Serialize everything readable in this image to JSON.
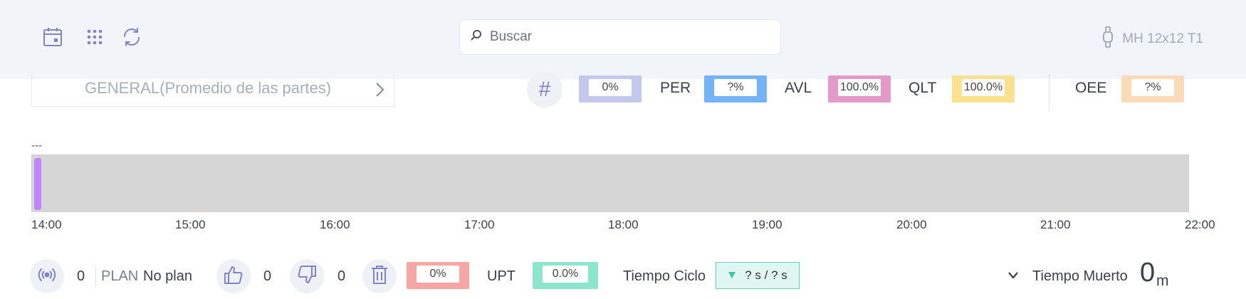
{
  "topbar": {
    "icons": [
      "calendar-icon",
      "grid-icon",
      "refresh-icon"
    ],
    "search": {
      "placeholder": "Buscar",
      "value": ""
    },
    "device": {
      "icon": "watch-icon",
      "name": "MH 12x12 T1"
    }
  },
  "part_selector": {
    "label": "GENERAL(Promedio de las partes)"
  },
  "metrics": {
    "hash_icon": "#",
    "count": {
      "value": "0%",
      "color": "#c5c8ee"
    },
    "per": {
      "label": "PER",
      "value": "?%",
      "color": "#74b3f7"
    },
    "avl": {
      "label": "AVL",
      "value": "100.0%",
      "color": "#e49ac8"
    },
    "qlt": {
      "label": "QLT",
      "value": "100.0%",
      "color": "#fbe08e"
    },
    "oee": {
      "label": "OEE",
      "value": "?%",
      "color": "#fcd9b7"
    }
  },
  "timeline": {
    "title": "---",
    "segment_color": "#c084fc",
    "segment_fraction": 0.01,
    "ticks": [
      "14:00",
      "15:00",
      "16:00",
      "17:00",
      "18:00",
      "19:00",
      "20:00",
      "21:00",
      "22:00"
    ]
  },
  "bottom": {
    "signal_count": "0",
    "plan_label": "PLAN",
    "plan_value": "No plan",
    "thumbs_up_count": "0",
    "thumbs_down_count": "0",
    "scrap": {
      "value": "0%",
      "color": "#f7a6a4"
    },
    "upt": {
      "label": "UPT",
      "value": "0.0%",
      "color": "#8de6cc"
    },
    "cycle_time": {
      "label": "Tiempo Ciclo",
      "value": "? s / ? s",
      "arrow_color": "#3cc7a1"
    },
    "dead_time": {
      "label": "Tiempo Muerto",
      "value": "0",
      "unit": "m"
    }
  }
}
